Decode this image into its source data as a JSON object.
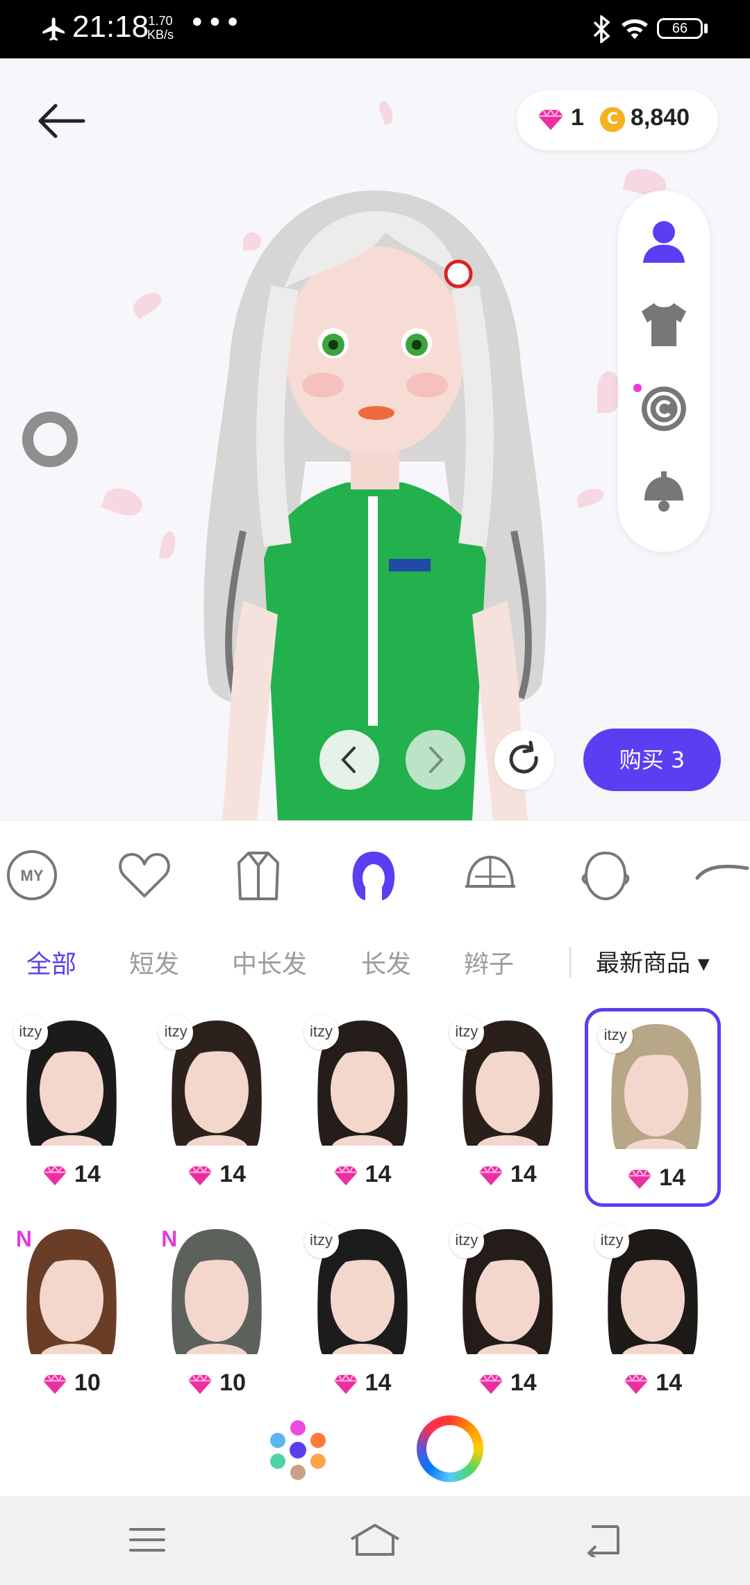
{
  "status_bar": {
    "time": "21:18",
    "speed_value": "1.70",
    "speed_unit": "KB/s",
    "dots": "•••",
    "battery": "66"
  },
  "header": {
    "gems": "1",
    "coins": "8,840",
    "coin_symbol": "C"
  },
  "actions": {
    "buy_label": "购买 3"
  },
  "categories": [
    "MY",
    "favorites",
    "outfit",
    "hair",
    "hat",
    "face",
    "eyebrow"
  ],
  "sub_tabs": [
    "全部",
    "短发",
    "中长发",
    "长发",
    "辫子"
  ],
  "sort_label": "最新商品 ▾",
  "items": [
    {
      "badge": "itzy",
      "price": "14",
      "color": "#1b1b1b"
    },
    {
      "badge": "itzy",
      "price": "14",
      "color": "#2c221d"
    },
    {
      "badge": "itzy",
      "price": "14",
      "color": "#241d19"
    },
    {
      "badge": "itzy",
      "price": "14",
      "color": "#2a1f1a"
    },
    {
      "badge": "itzy",
      "price": "14",
      "color": "#b8a787",
      "selected": true
    },
    {
      "badge": "N",
      "price": "10",
      "color": "#6a3d26"
    },
    {
      "badge": "N",
      "price": "10",
      "color": "#5c615c"
    },
    {
      "badge": "itzy",
      "price": "14",
      "color": "#1c1c1c"
    },
    {
      "badge": "itzy",
      "price": "14",
      "color": "#241c18"
    },
    {
      "badge": "itzy",
      "price": "14",
      "color": "#1e1a18"
    }
  ],
  "accent_color": "#5a3ef2",
  "gem_color": "#ec2fa0"
}
